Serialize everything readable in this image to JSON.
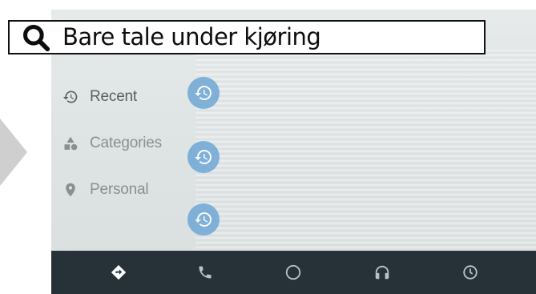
{
  "caption": {
    "text": "Bare tale under kjøring",
    "icon": "search-icon"
  },
  "sidebar": {
    "items": [
      {
        "label": "Recent",
        "icon": "history-icon",
        "active": true
      },
      {
        "label": "Categories",
        "icon": "categories-icon",
        "active": false
      },
      {
        "label": "Personal",
        "icon": "location-pin-icon",
        "active": false
      }
    ]
  },
  "list": {
    "item_icons": [
      "history-icon",
      "history-icon",
      "history-icon"
    ]
  },
  "bottom_nav": {
    "items": [
      {
        "name": "navigation",
        "icon": "directions-icon"
      },
      {
        "name": "phone",
        "icon": "phone-icon"
      },
      {
        "name": "home",
        "icon": "home-circle-icon"
      },
      {
        "name": "music",
        "icon": "headphones-icon"
      },
      {
        "name": "overview",
        "icon": "clock-icon"
      }
    ]
  },
  "colors": {
    "navbar": "#263238",
    "accent": "#6ea7d6",
    "menu_text": "#8a8f93"
  }
}
